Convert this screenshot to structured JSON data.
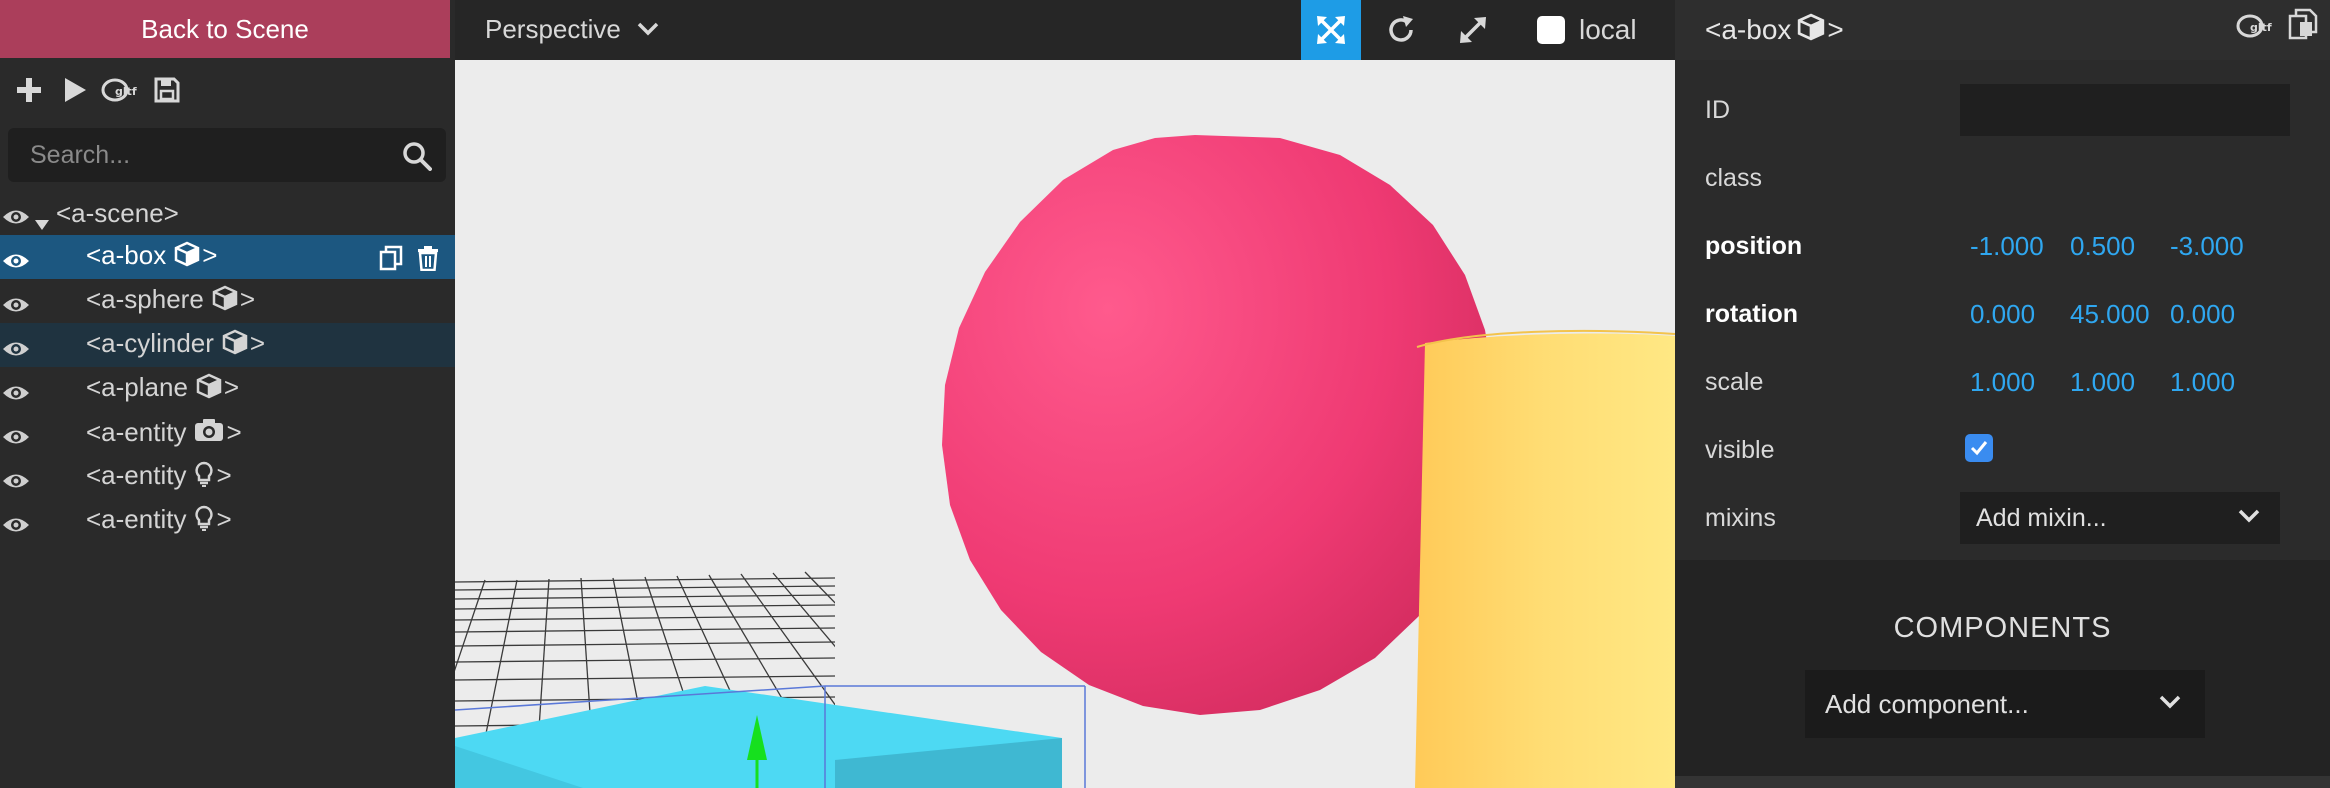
{
  "left_panel": {
    "back_button": "Back to Scene",
    "search": {
      "placeholder": "Search..."
    },
    "tree": {
      "root": "<a-scene>",
      "items": [
        {
          "label": "<a-box",
          "suffix": ">",
          "icon": "cube-icon",
          "selected": true
        },
        {
          "label": "<a-sphere",
          "suffix": ">",
          "icon": "cube-icon"
        },
        {
          "label": "<a-cylinder",
          "suffix": ">",
          "icon": "cube-icon",
          "hover": true
        },
        {
          "label": "<a-plane",
          "suffix": ">",
          "icon": "cube-icon"
        },
        {
          "label": "<a-entity",
          "suffix": ">",
          "icon": "camera-icon"
        },
        {
          "label": "<a-entity",
          "suffix": ">",
          "icon": "lightbulb-icon"
        },
        {
          "label": "<a-entity",
          "suffix": ">",
          "icon": "lightbulb-icon"
        }
      ]
    }
  },
  "toolbar": {
    "camera": "Perspective",
    "local_label": "local",
    "local_checked": false
  },
  "inspector": {
    "entity_title": "<a-box",
    "entity_suffix": ">",
    "id_label": "ID",
    "id_value": "",
    "class_label": "class",
    "position": {
      "label": "position",
      "x": "-1.000",
      "y": "0.500",
      "z": "-3.000"
    },
    "rotation": {
      "label": "rotation",
      "x": "0.000",
      "y": "45.000",
      "z": "0.000"
    },
    "scale": {
      "label": "scale",
      "x": "1.000",
      "y": "1.000",
      "z": "1.000"
    },
    "visible": {
      "label": "visible",
      "checked": true
    },
    "mixins": {
      "label": "mixins",
      "selected": "Add mixin..."
    },
    "components_title": "COMPONENTS",
    "add_component": "Add component..."
  },
  "colors": {
    "back_button": "#ab3e5b",
    "selected_row": "#1c5780",
    "active_tool": "#1e9ce6",
    "vector_value": "#2fa7f0",
    "sphere": "#ef3a73",
    "cylinder": "#ffd968",
    "box": "#4cd8f2"
  }
}
